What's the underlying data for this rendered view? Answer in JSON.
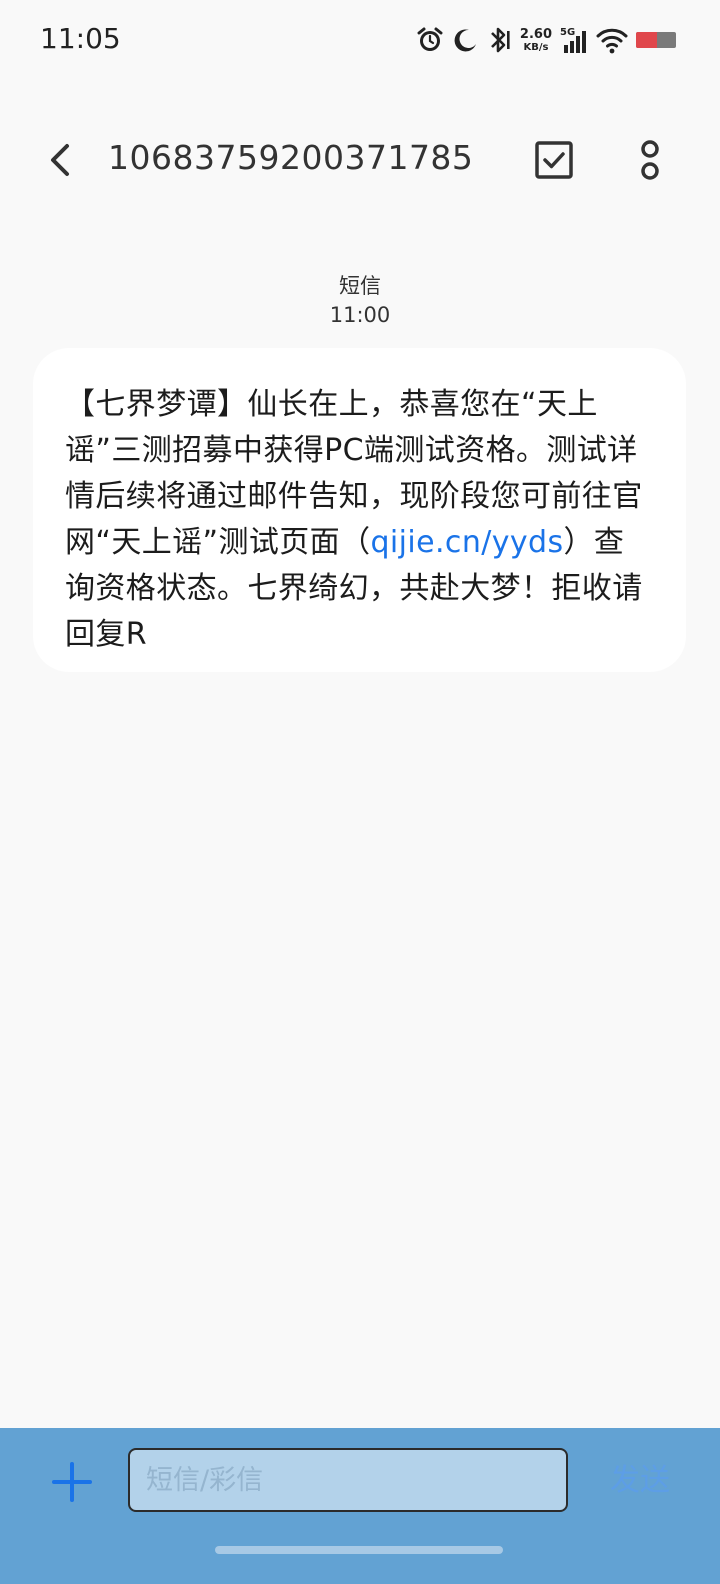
{
  "status_bar": {
    "time": "11:05",
    "net_speed_value": "2.60",
    "net_speed_unit": "KB/s",
    "network_type": "5G",
    "icons": [
      "alarm-icon",
      "moon-icon",
      "bluetooth-icon",
      "signal-icon",
      "wifi-icon",
      "battery-icon"
    ],
    "battery_level": 0.52
  },
  "header": {
    "back_icon": "chevron-left-icon",
    "title": "10683759200371785",
    "select_icon": "checkbox-icon",
    "more_icon": "more-vertical-icon"
  },
  "message": {
    "channel": "短信",
    "time": "11:00",
    "text_before_link": "【七界梦谭】仙长在上，恭喜您在“天上谣”三测招募中获得PC端测试资格。测试详情后续将通过邮件告知，现阶段您可前往官网“天上谣”测试页面（",
    "link": "qijie.cn/yyds",
    "text_after_link": "）查询资格状态。七界绮幻，共赴大梦！拒收请回复R"
  },
  "composer": {
    "add_icon": "plus-icon",
    "input_placeholder": "短信/彩信",
    "input_value": "",
    "send_label": "发送"
  },
  "colors": {
    "background": "#f9f9f9",
    "bubble": "#ffffff",
    "link": "#1a73e8",
    "composer_bar": "#62a2d3",
    "send": "#5d9ee6",
    "battery_low": "#e0474c"
  }
}
